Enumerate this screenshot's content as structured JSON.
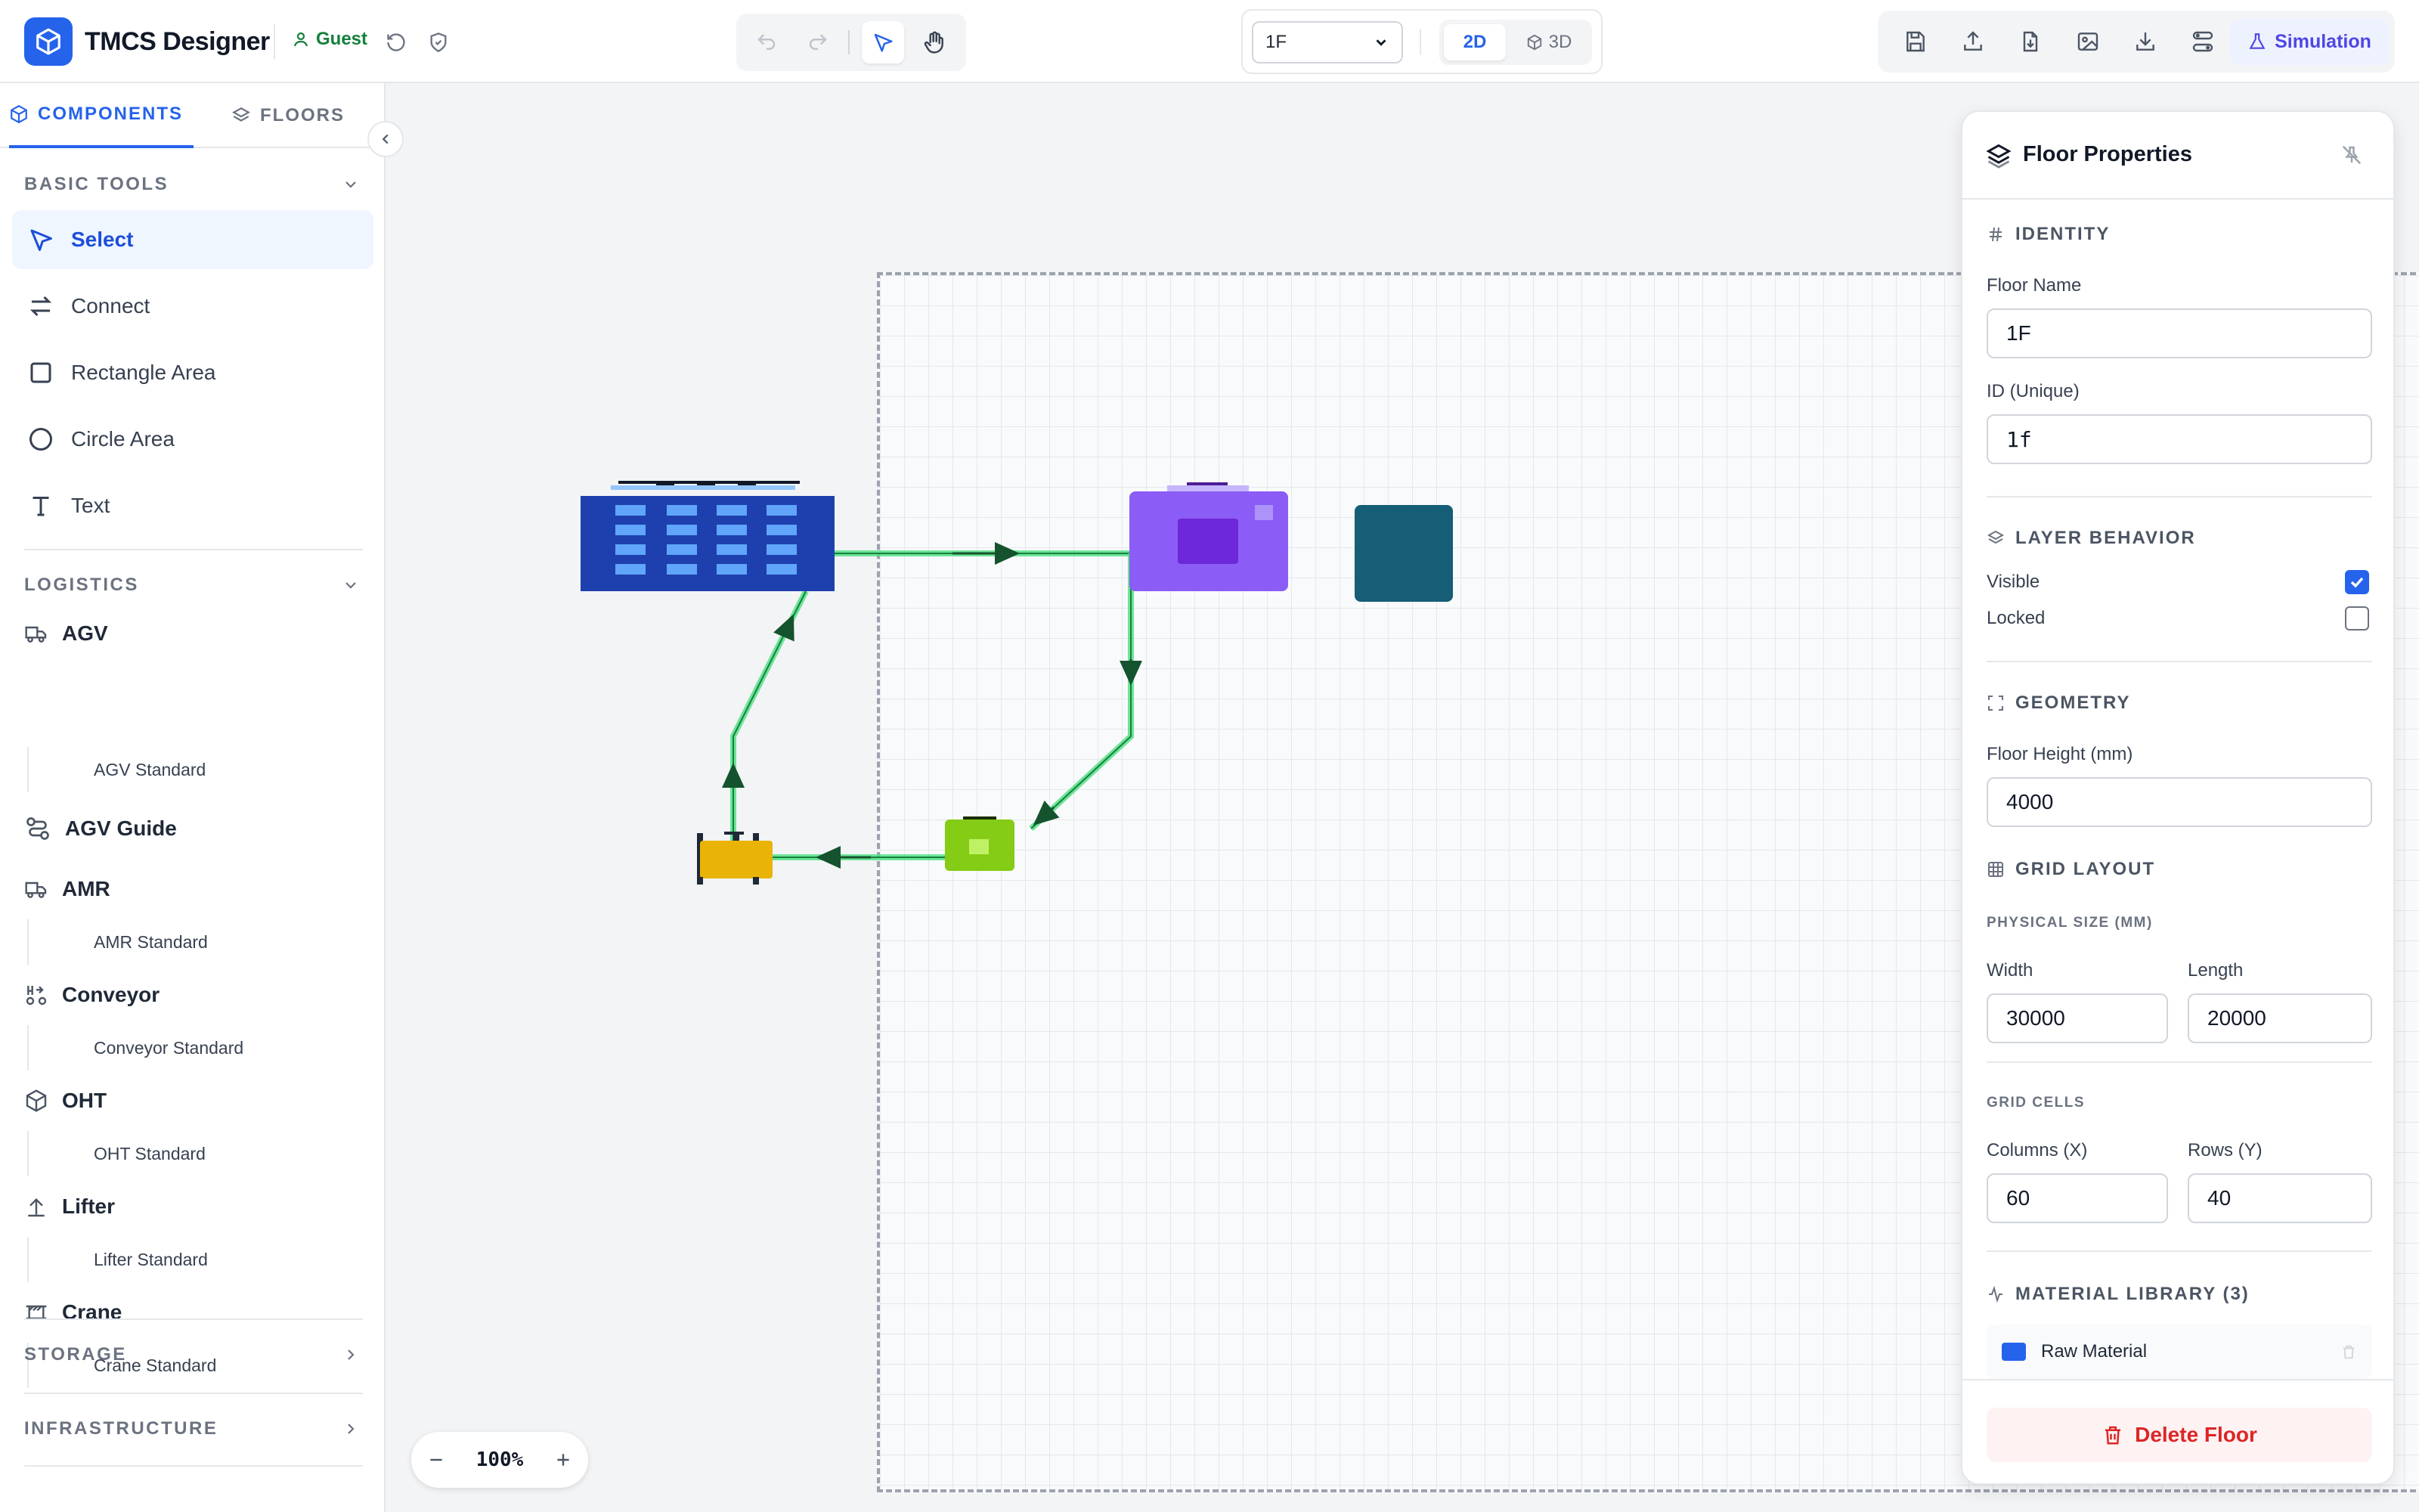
{
  "app": {
    "title": "TMCS Designer",
    "user": "Guest"
  },
  "toolbar": {
    "floor_select": "1F",
    "view_2d": "2D",
    "view_3d": "3D",
    "simulation_label": "Simulation"
  },
  "sidebar": {
    "tabs": [
      "COMPONENTS",
      "FLOORS"
    ],
    "basic_tools_title": "BASIC TOOLS",
    "tools": [
      "Select",
      "Connect",
      "Rectangle Area",
      "Circle Area",
      "Text"
    ],
    "logistics_title": "LOGISTICS",
    "categories": [
      {
        "name": "AGV",
        "sub": "AGV Standard"
      },
      {
        "name": "AGV Guide",
        "sub": ""
      },
      {
        "name": "AMR",
        "sub": "AMR Standard"
      },
      {
        "name": "Conveyor",
        "sub": "Conveyor Standard"
      },
      {
        "name": "OHT",
        "sub": "OHT Standard"
      },
      {
        "name": "Lifter",
        "sub": "Lifter Standard"
      },
      {
        "name": "Crane",
        "sub": "Crane Standard"
      }
    ],
    "storage_title": "STORAGE",
    "infrastructure_title": "INFRASTRUCTURE"
  },
  "canvas": {
    "zoom": "100%"
  },
  "panel": {
    "title": "Floor Properties",
    "identity_title": "IDENTITY",
    "floor_name_label": "Floor Name",
    "floor_name_value": "1F",
    "id_label": "ID (Unique)",
    "id_value": "1f",
    "layer_title": "LAYER BEHAVIOR",
    "visible_label": "Visible",
    "locked_label": "Locked",
    "visible": true,
    "locked": false,
    "geometry_title": "GEOMETRY",
    "floor_height_label": "Floor Height (mm)",
    "floor_height_value": "4000",
    "grid_title": "GRID LAYOUT",
    "physical_size_label": "PHYSICAL SIZE (MM)",
    "width_label": "Width",
    "width_value": "30000",
    "length_label": "Length",
    "length_value": "20000",
    "grid_cells_label": "GRID CELLS",
    "columns_label": "Columns (X)",
    "columns_value": "60",
    "rows_label": "Rows (Y)",
    "rows_value": "40",
    "material_title": "MATERIAL LIBRARY (3)",
    "material_first": "Raw Material",
    "delete_label": "Delete Floor"
  },
  "colors": {
    "accent": "#2563eb",
    "building": "#1e40af",
    "machine_purple": "#8b5cf6",
    "machine_teal": "#155e75",
    "station_green": "#84cc16",
    "vehicle_yellow": "#eab308",
    "path": "#4ade80",
    "danger": "#dc2626"
  }
}
